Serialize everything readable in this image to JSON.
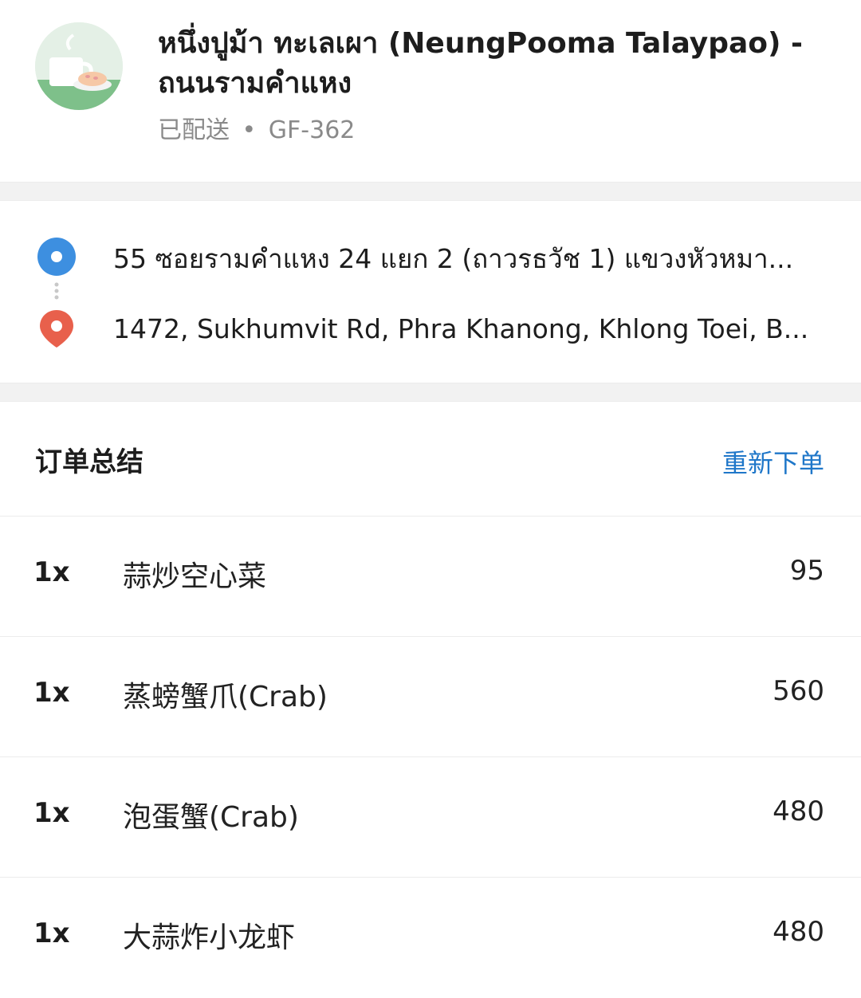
{
  "restaurant": {
    "name": "หนึ่งปูม้า ทะเลเผา (NeungPooma Talaypao) - ถนนรามคำแหง",
    "status": "已配送",
    "separator": "•",
    "order_code": "GF-362",
    "logo_icon": "coffee-cup-logo"
  },
  "route": {
    "origin": "55 ซอยรามคำแหง 24 แยก 2 (ถาวรธวัช 1) แขวงหัวหมา...",
    "destination": "1472, Sukhumvit Rd, Phra Khanong, Khlong Toei, B...",
    "origin_icon": "origin-dot-icon",
    "destination_icon": "map-pin-icon",
    "origin_color": "#3d8fe0",
    "destination_color": "#e8604c"
  },
  "summary": {
    "title": "订单总结",
    "reorder_label": "重新下单",
    "accent": "#1f77c9"
  },
  "items": [
    {
      "qty": "1x",
      "name": "蒜炒空心菜",
      "price": "95"
    },
    {
      "qty": "1x",
      "name": "蒸螃蟹爪(Crab)",
      "price": "560"
    },
    {
      "qty": "1x",
      "name": "泡蛋蟹(Crab)",
      "price": "480"
    },
    {
      "qty": "1x",
      "name": "大蒜炸小龙虾",
      "price": "480"
    }
  ]
}
